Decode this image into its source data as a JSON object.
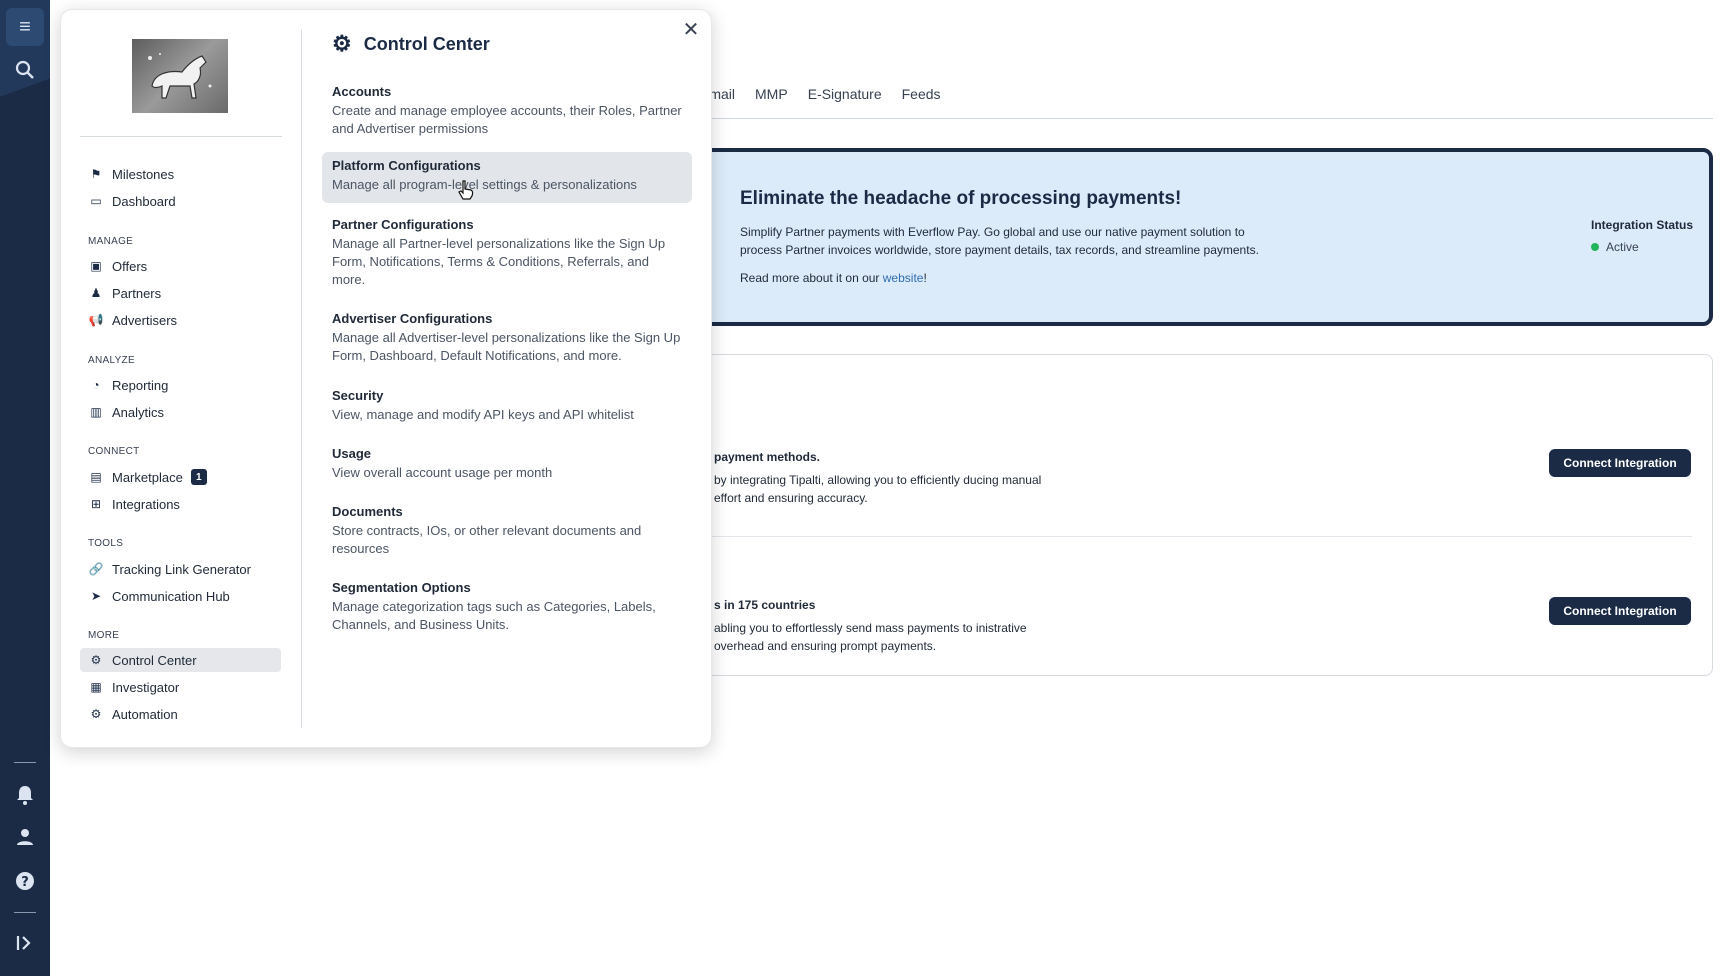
{
  "rail": {
    "menu_icon": "≡",
    "search_icon": "⌕",
    "bell_icon": "🔔",
    "user_icon": "👤",
    "help_icon": "?",
    "expand_icon": "⇥"
  },
  "tabs": [
    "Email",
    "MMP",
    "E-Signature",
    "Feeds"
  ],
  "promo": {
    "title": "Eliminate the headache of processing payments!",
    "text": "Simplify Partner payments with Everflow Pay. Go global and use our native payment solution to process Partner invoices worldwide, store payment details, tax records, and streamline payments.",
    "more_prefix": "Read more about it on our ",
    "more_link": "website",
    "more_suffix": "!",
    "status_label": "Integration Status",
    "status_value": "Active"
  },
  "integrations": [
    {
      "title": "payment methods.",
      "desc": "by integrating Tipalti, allowing you to efficiently ducing manual effort and ensuring accuracy.",
      "button": "Connect Integration"
    },
    {
      "title": "s in 175 countries",
      "desc": "abling you to effortlessly send mass payments to inistrative overhead and ensuring prompt payments.",
      "button": "Connect Integration"
    }
  ],
  "panel": {
    "close_icon": "✕",
    "nav": {
      "top": [
        {
          "label": "Milestones",
          "icon": "⚑"
        },
        {
          "label": "Dashboard",
          "icon": "▭"
        }
      ],
      "manage_label": "MANAGE",
      "manage": [
        {
          "label": "Offers",
          "icon": "▣"
        },
        {
          "label": "Partners",
          "icon": "♟"
        },
        {
          "label": "Advertisers",
          "icon": "📢"
        }
      ],
      "analyze_label": "ANALYZE",
      "analyze": [
        {
          "label": "Reporting",
          "icon": "◔"
        },
        {
          "label": "Analytics",
          "icon": "▥"
        }
      ],
      "connect_label": "CONNECT",
      "connect": [
        {
          "label": "Marketplace",
          "icon": "▤",
          "badge": "1"
        },
        {
          "label": "Integrations",
          "icon": "⊞"
        }
      ],
      "tools_label": "TOOLS",
      "tools": [
        {
          "label": "Tracking Link Generator",
          "icon": "🔗"
        },
        {
          "label": "Communication Hub",
          "icon": "➤"
        }
      ],
      "more_label": "MORE",
      "more": [
        {
          "label": "Control Center",
          "icon": "⚙"
        },
        {
          "label": "Investigator",
          "icon": "▦"
        },
        {
          "label": "Automation",
          "icon": "⚙"
        }
      ]
    },
    "title": "Control Center",
    "title_icon": "⚙",
    "options": [
      {
        "title": "Accounts",
        "desc": "Create and manage employee accounts, their Roles, Partner and Advertiser permissions"
      },
      {
        "title": "Platform Configurations",
        "desc": "Manage all program-level settings & personalizations"
      },
      {
        "title": "Partner Configurations",
        "desc": "Manage all Partner-level personalizations like the Sign Up Form, Notifications, Terms & Conditions, Referrals, and more."
      },
      {
        "title": "Advertiser Configurations",
        "desc": "Manage all Advertiser-level personalizations like the Sign Up Form, Dashboard, Default Notifications, and more."
      },
      {
        "title": "Security",
        "desc": "View, manage and modify API keys and API whitelist"
      },
      {
        "title": "Usage",
        "desc": "View overall account usage per month"
      },
      {
        "title": "Documents",
        "desc": "Store contracts, IOs, or other relevant documents and resources"
      },
      {
        "title": "Segmentation Options",
        "desc": "Manage categorization tags such as Categories, Labels, Channels, and Business Units."
      }
    ]
  }
}
